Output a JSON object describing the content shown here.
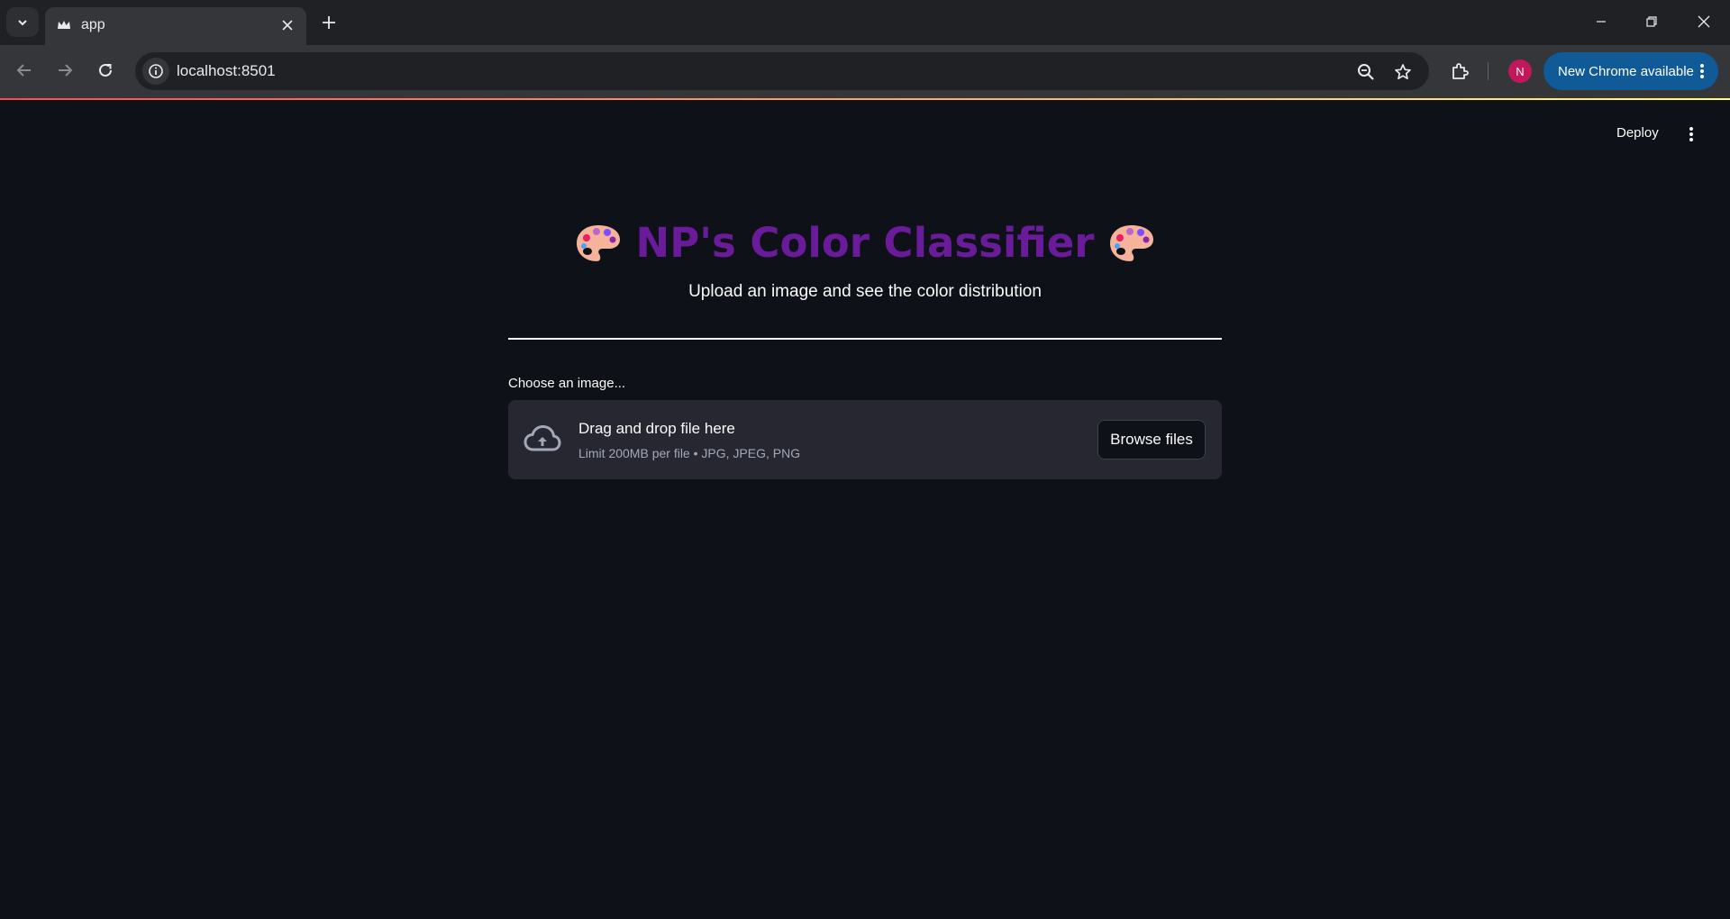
{
  "browser": {
    "tab_title": "app",
    "url": "localhost:8501",
    "update_label": "New Chrome available",
    "profile_initial": "N"
  },
  "app_header": {
    "deploy_label": "Deploy"
  },
  "main": {
    "title": "NP's Color Classifier",
    "subtitle": "Upload an image and see the color distribution",
    "uploader": {
      "label": "Choose an image...",
      "drop_title": "Drag and drop file here",
      "drop_subtitle": "Limit 200MB per file • JPG, JPEG, PNG",
      "browse_label": "Browse files"
    }
  },
  "colors": {
    "title": "#6a1b9a",
    "background": "#0e1117",
    "dropzone": "#262730",
    "accent_gradient_start": "#ff4b4b",
    "accent_gradient_end": "#fffd80"
  },
  "icons": {
    "title_decoration": "palette-icon",
    "upload": "cloud-upload-icon"
  }
}
